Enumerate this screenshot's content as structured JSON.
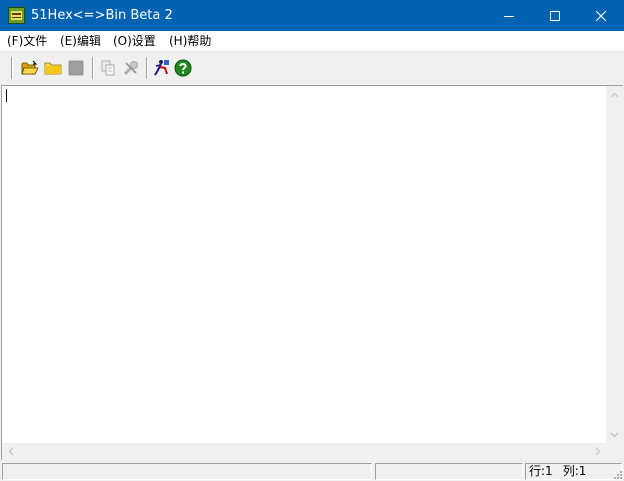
{
  "window": {
    "title": "51Hex<=>Bin Beta 2"
  },
  "menu": [
    {
      "label": "(F)文件"
    },
    {
      "label": "(E)编辑"
    },
    {
      "label": "(O)设置"
    },
    {
      "label": "(H)帮助"
    }
  ],
  "toolbar": {
    "icons": [
      "open-folder-icon",
      "new-folder-icon",
      "stop-icon",
      "copy-icon",
      "tools-icon",
      "convert-icon",
      "help-icon"
    ]
  },
  "editor": {
    "content": ""
  },
  "status": {
    "pane1": "",
    "pane2": "",
    "line": "行:1",
    "column": "列:1"
  },
  "colors": {
    "titlebar": "#0063b1",
    "help_icon": "#1e8a1e",
    "folder": "#f2c81e"
  }
}
